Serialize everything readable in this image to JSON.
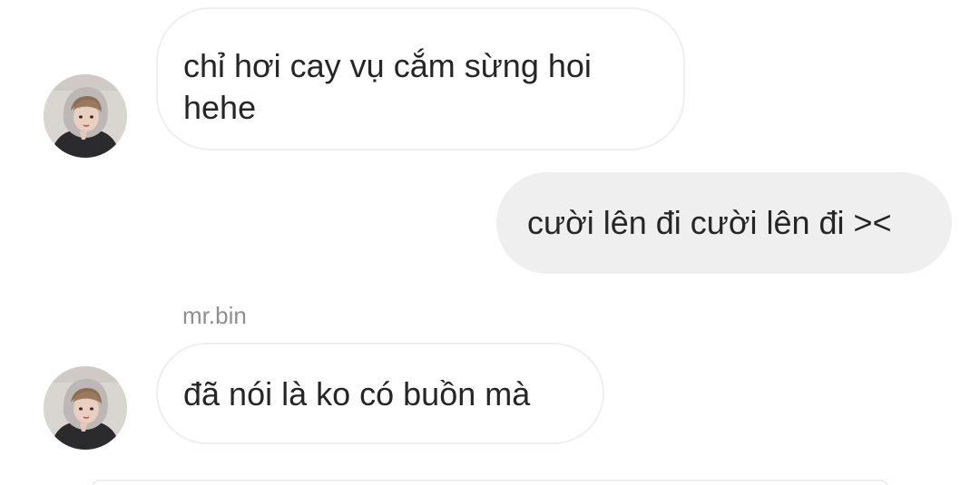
{
  "conversation": {
    "messages": [
      {
        "direction": "incoming",
        "text": "chỉ hơi cay vụ cắm sừng hoi\nhehe"
      },
      {
        "direction": "outgoing",
        "text": "cười lên đi cười lên đi ><"
      },
      {
        "direction": "incoming",
        "sender": "mr.bin",
        "text": "đã nói là ko có buồn mà"
      }
    ]
  },
  "colors": {
    "incoming_bubble_border": "#efefef",
    "outgoing_bubble_bg": "#efefef",
    "text": "#262626",
    "sender_name": "#8e8e8e"
  },
  "icons": {
    "avatar": "profile-photo-hooded-person"
  }
}
